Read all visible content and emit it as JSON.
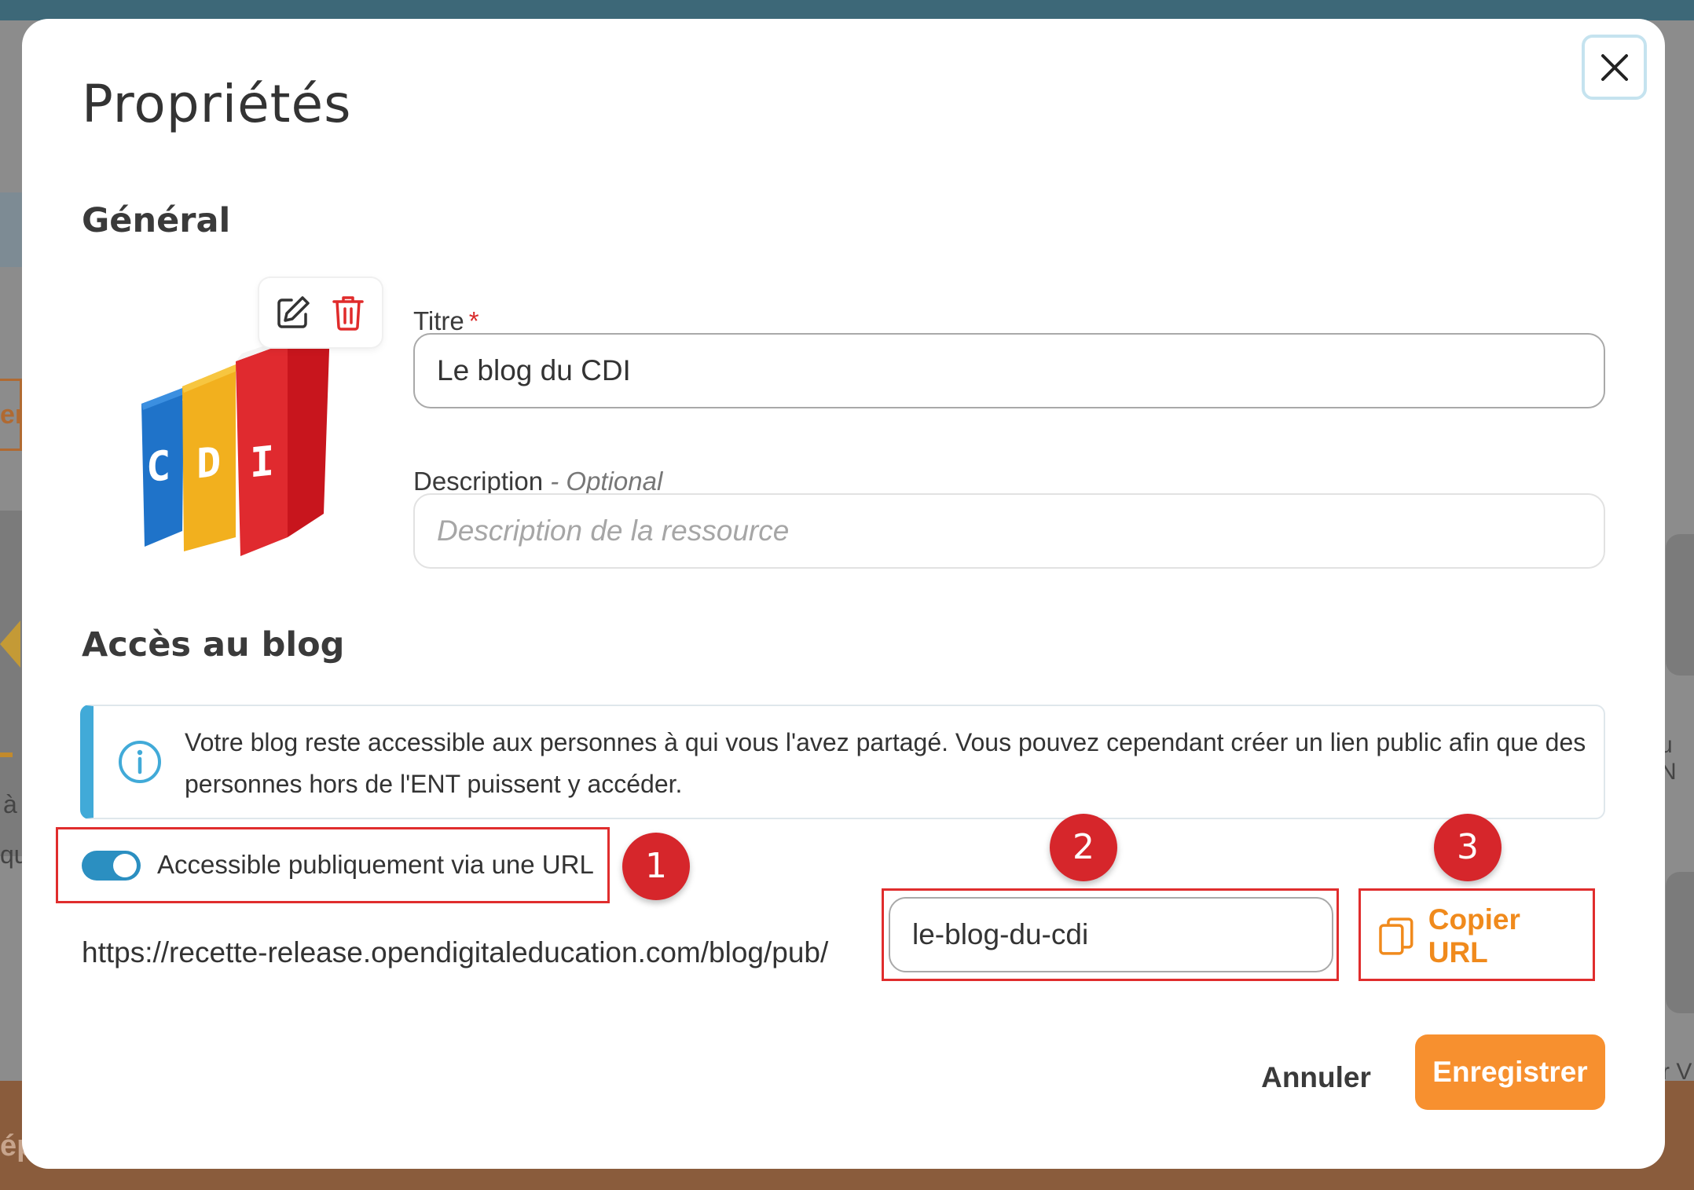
{
  "background": {
    "left_button_fragment": "er",
    "left_text_1": "à",
    "left_text_2": "qu",
    "right_text_1": "u N",
    "right_text_2": "r V",
    "bottom_text": "ép"
  },
  "modal": {
    "title": "Propriétés",
    "close_icon": "close-icon"
  },
  "general": {
    "heading": "Général",
    "image_alt": "CDI",
    "edit_icon": "edit-icon",
    "delete_icon": "trash-icon",
    "title_label": "Titre",
    "title_required_mark": "*",
    "title_value": "Le blog du CDI",
    "description_label": "Description",
    "description_optional": "- Optional",
    "description_placeholder": "Description de la ressource"
  },
  "access": {
    "heading": "Accès au blog",
    "info_icon": "info-icon",
    "info_text": "Votre blog reste accessible aux personnes à qui vous l'avez partagé. Vous pouvez cependant créer un lien public afin que des personnes hors de l'ENT puissent y accéder.",
    "toggle_label": "Accessible publiquement via une URL",
    "toggle_on": true,
    "url_prefix": "https://recette-release.opendigitaleducation.com/blog/pub/",
    "slug_value": "le-blog-du-cdi",
    "copy_icon": "copy-icon",
    "copy_label": "Copier URL"
  },
  "annotations": {
    "badge_1": "1",
    "badge_2": "2",
    "badge_3": "3"
  },
  "footer": {
    "cancel_label": "Annuler",
    "save_label": "Enregistrer"
  },
  "colors": {
    "accent_orange": "#f7902f",
    "copy_orange": "#f08a1c",
    "toggle_blue": "#2b8fc1",
    "info_border": "#41aad8",
    "annotation_red": "#d6262b",
    "required_red": "#d92b2b"
  }
}
